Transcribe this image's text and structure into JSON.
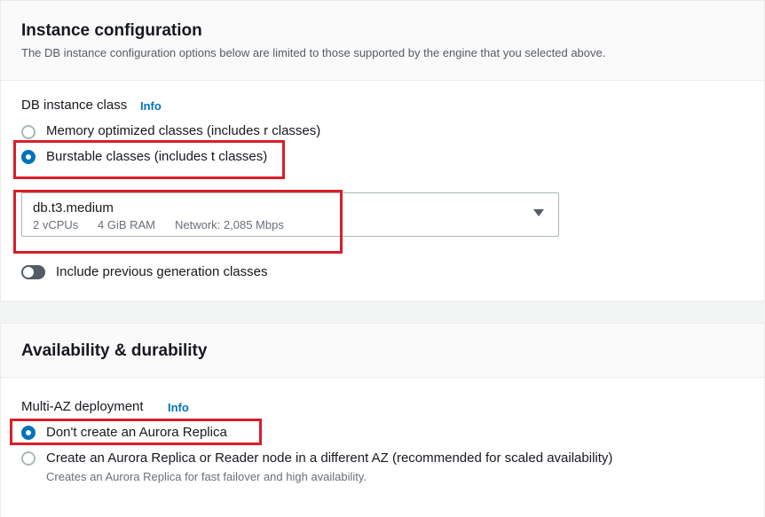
{
  "instance": {
    "title": "Instance configuration",
    "description": "The DB instance configuration options below are limited to those supported by the engine that you selected above.",
    "class_label": "DB instance class",
    "info": "Info",
    "options": [
      {
        "label": "Memory optimized classes (includes r classes)",
        "selected": false
      },
      {
        "label": "Burstable classes (includes t classes)",
        "selected": true
      }
    ],
    "select": {
      "value": "db.t3.medium",
      "vcpus": "2 vCPUs",
      "ram": "4 GiB RAM",
      "network": "Network: 2,085 Mbps"
    },
    "toggle_label": "Include previous generation classes",
    "toggle_on": false
  },
  "availability": {
    "title": "Availability & durability",
    "multi_az_label": "Multi-AZ deployment",
    "info": "Info",
    "options": [
      {
        "label": "Don't create an Aurora Replica",
        "selected": true
      },
      {
        "label": "Create an Aurora Replica or Reader node in a different AZ (recommended for scaled availability)",
        "selected": false,
        "description": "Creates an Aurora Replica for fast failover and high availability."
      }
    ]
  },
  "colors": {
    "accent": "#0073bb",
    "highlight": "#d91e2a"
  }
}
